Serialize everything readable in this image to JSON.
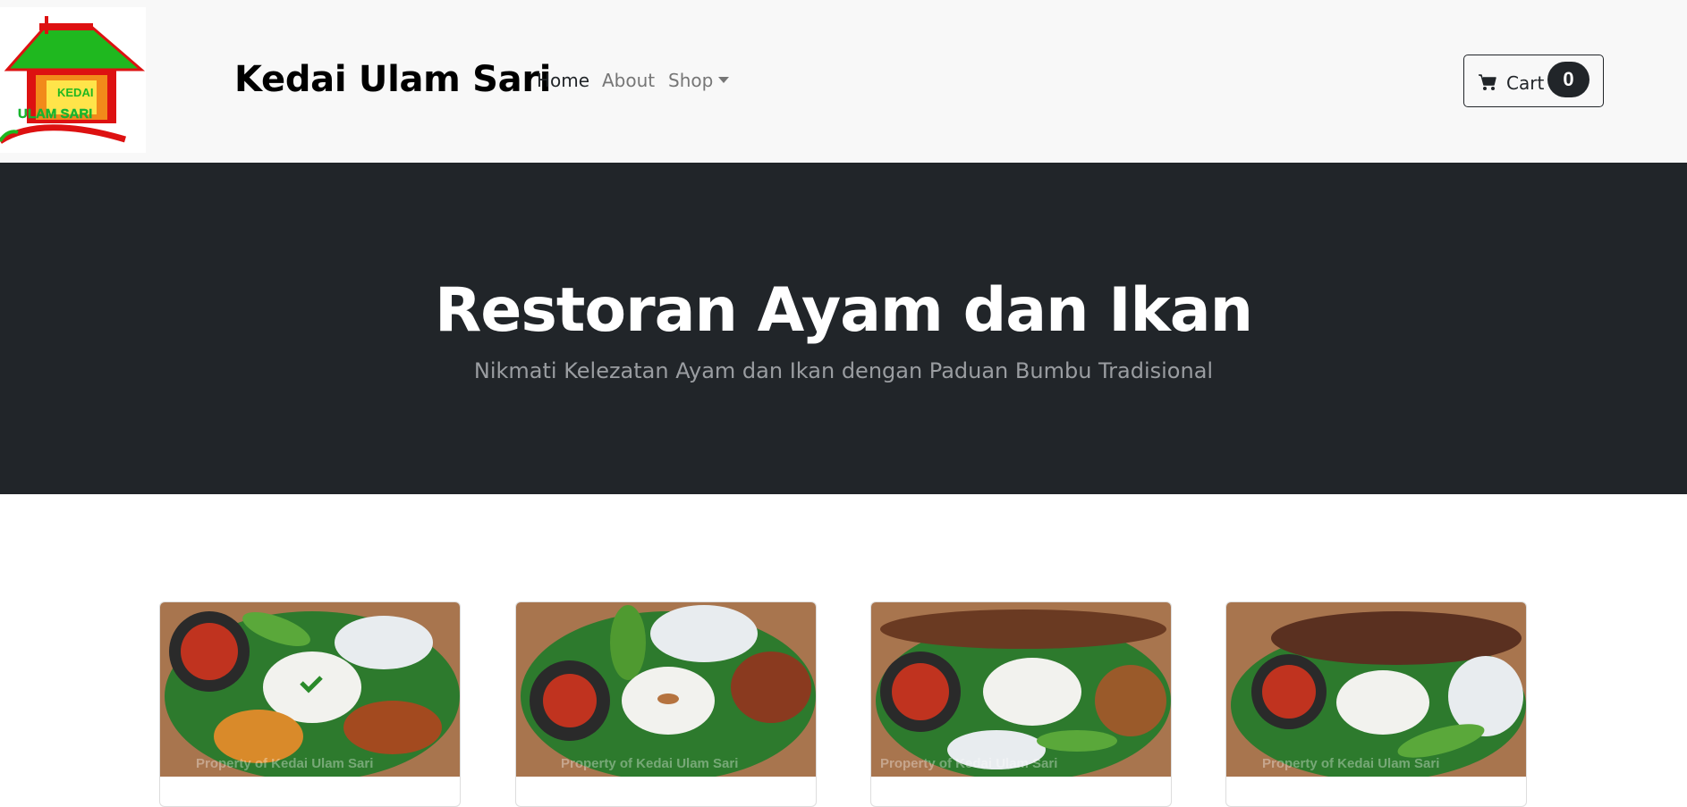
{
  "brand": {
    "logo_text": "KEDAI ULAM SARI",
    "name": "Kedai Ulam Sari"
  },
  "nav": {
    "home": "Home",
    "about": "About",
    "shop": "Shop"
  },
  "cart": {
    "label": "Cart",
    "count": "0"
  },
  "hero": {
    "title": "Restoran Ayam dan Ikan",
    "subtitle": "Nikmati Kelezatan Ayam dan Ikan dengan Paduan Bumbu Tradisional"
  },
  "products": [
    {
      "image_icon": "food-photo-icon",
      "watermark": "Property of Kedai Ulam Sari"
    },
    {
      "image_icon": "food-photo-icon",
      "watermark": "Property of Kedai Ulam Sari"
    },
    {
      "image_icon": "food-photo-icon",
      "watermark": "Property of Kedai Ulam Sari"
    },
    {
      "image_icon": "food-photo-icon",
      "watermark": "Property of Kedai Ulam Sari"
    }
  ],
  "colors": {
    "navbar_bg": "#f8f8f8",
    "hero_bg": "#212529",
    "hero_title": "#ffffff",
    "hero_subtitle": "#9a9da1",
    "brand_text": "#000000"
  }
}
